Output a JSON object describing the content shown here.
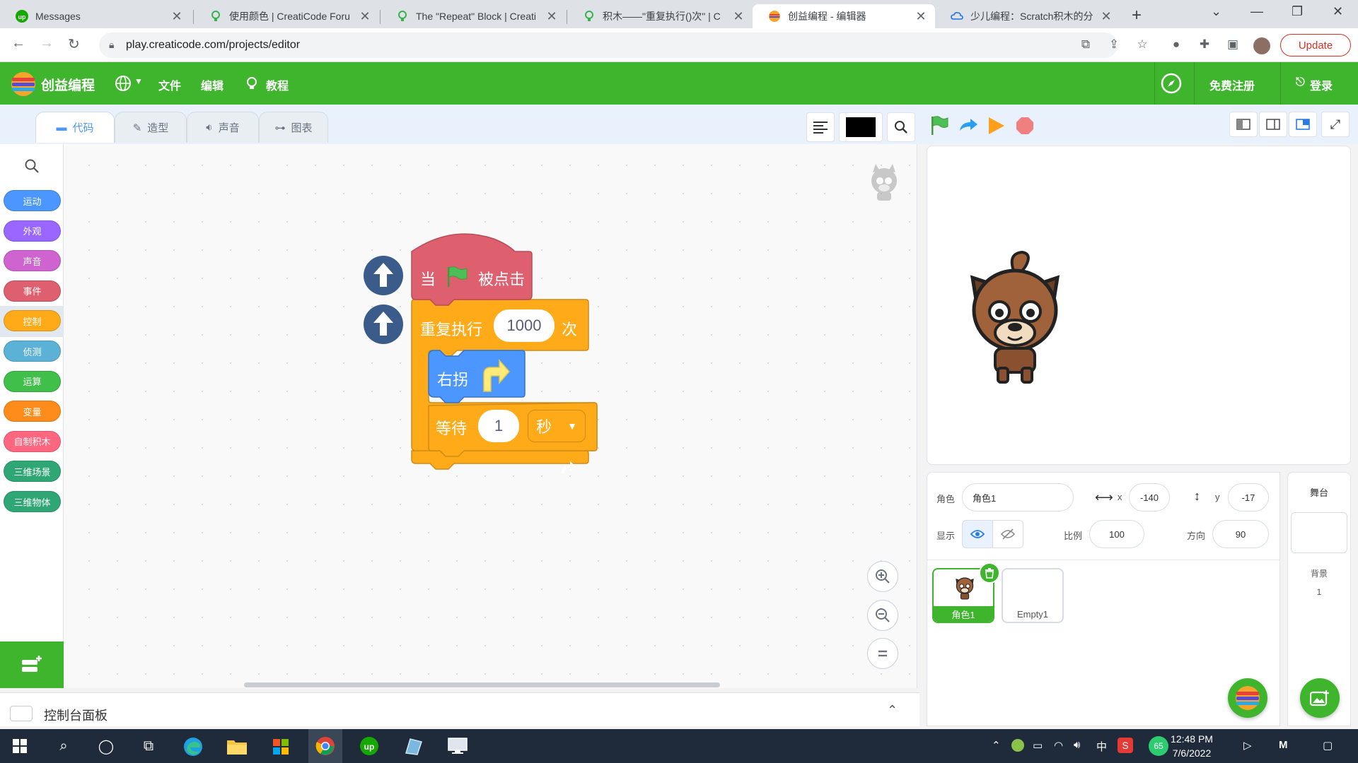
{
  "browser": {
    "tabs": [
      {
        "title": "Messages",
        "active": false
      },
      {
        "title": "使用颜色 | CreatiCode Foru",
        "active": false
      },
      {
        "title": "The \"Repeat\" Block | Creati",
        "active": false
      },
      {
        "title": "积木——\"重复执行()次\" | C",
        "active": false
      },
      {
        "title": "创益编程 - 编辑器",
        "active": true
      },
      {
        "title": "少儿编程：Scratch积木的分",
        "active": false
      }
    ],
    "new_tab": "+",
    "url": "play.creaticode.com/projects/editor",
    "update_label": "Update"
  },
  "header": {
    "app_name": "创益编程",
    "menu_file": "文件",
    "menu_edit": "编辑",
    "menu_tutorial": "教程",
    "register": "免费注册",
    "login": "登录"
  },
  "editor_tabs": [
    {
      "label": "代码",
      "active": true
    },
    {
      "label": "造型",
      "active": false
    },
    {
      "label": "声音",
      "active": false
    },
    {
      "label": "图表",
      "active": false
    }
  ],
  "palette": {
    "categories": [
      {
        "label": "运动",
        "color": "#4c97ff"
      },
      {
        "label": "外观",
        "color": "#9966ff"
      },
      {
        "label": "声音",
        "color": "#cf63cf"
      },
      {
        "label": "事件",
        "color": "#de5f6e"
      },
      {
        "label": "控制",
        "color": "#ffab19"
      },
      {
        "label": "侦测",
        "color": "#5cb1d6"
      },
      {
        "label": "运算",
        "color": "#40bf4a"
      },
      {
        "label": "变量",
        "color": "#ff8c1a"
      },
      {
        "label": "自制积木",
        "color": "#ff6680"
      },
      {
        "label": "三维场景",
        "color": "#2fa775"
      },
      {
        "label": "三维物体",
        "color": "#2fa775"
      }
    ],
    "selected": "控制"
  },
  "script": {
    "hat_when": "当",
    "hat_clicked": "被点击",
    "repeat_label": "重复执行",
    "repeat_count": "1000",
    "repeat_suffix": "次",
    "turn_label": "右拐",
    "wait_label": "等待",
    "wait_value": "1",
    "wait_unit": "秒"
  },
  "console": {
    "label": "控制台面板"
  },
  "sprite_info": {
    "sprite_label": "角色",
    "sprite_name": "角色1",
    "x_label": "x",
    "x_value": "-140",
    "y_label": "y",
    "y_value": "-17",
    "show_label": "显示",
    "size_label": "比例",
    "size_value": "100",
    "direction_label": "方向",
    "direction_value": "90"
  },
  "sprites": [
    {
      "name": "角色1",
      "selected": true
    },
    {
      "name": "Empty1",
      "selected": false
    }
  ],
  "stage_panel": {
    "title": "舞台",
    "backdrop_label": "背景",
    "backdrop_count": "1"
  },
  "taskbar": {
    "time": "12:48 PM",
    "date": "7/6/2022",
    "ime": "中",
    "badge": "65"
  },
  "colors": {
    "brand_green": "#3fb42d",
    "control_orange": "#ffab19",
    "events_red": "#de5f6e",
    "motion_blue": "#4c97ff"
  }
}
